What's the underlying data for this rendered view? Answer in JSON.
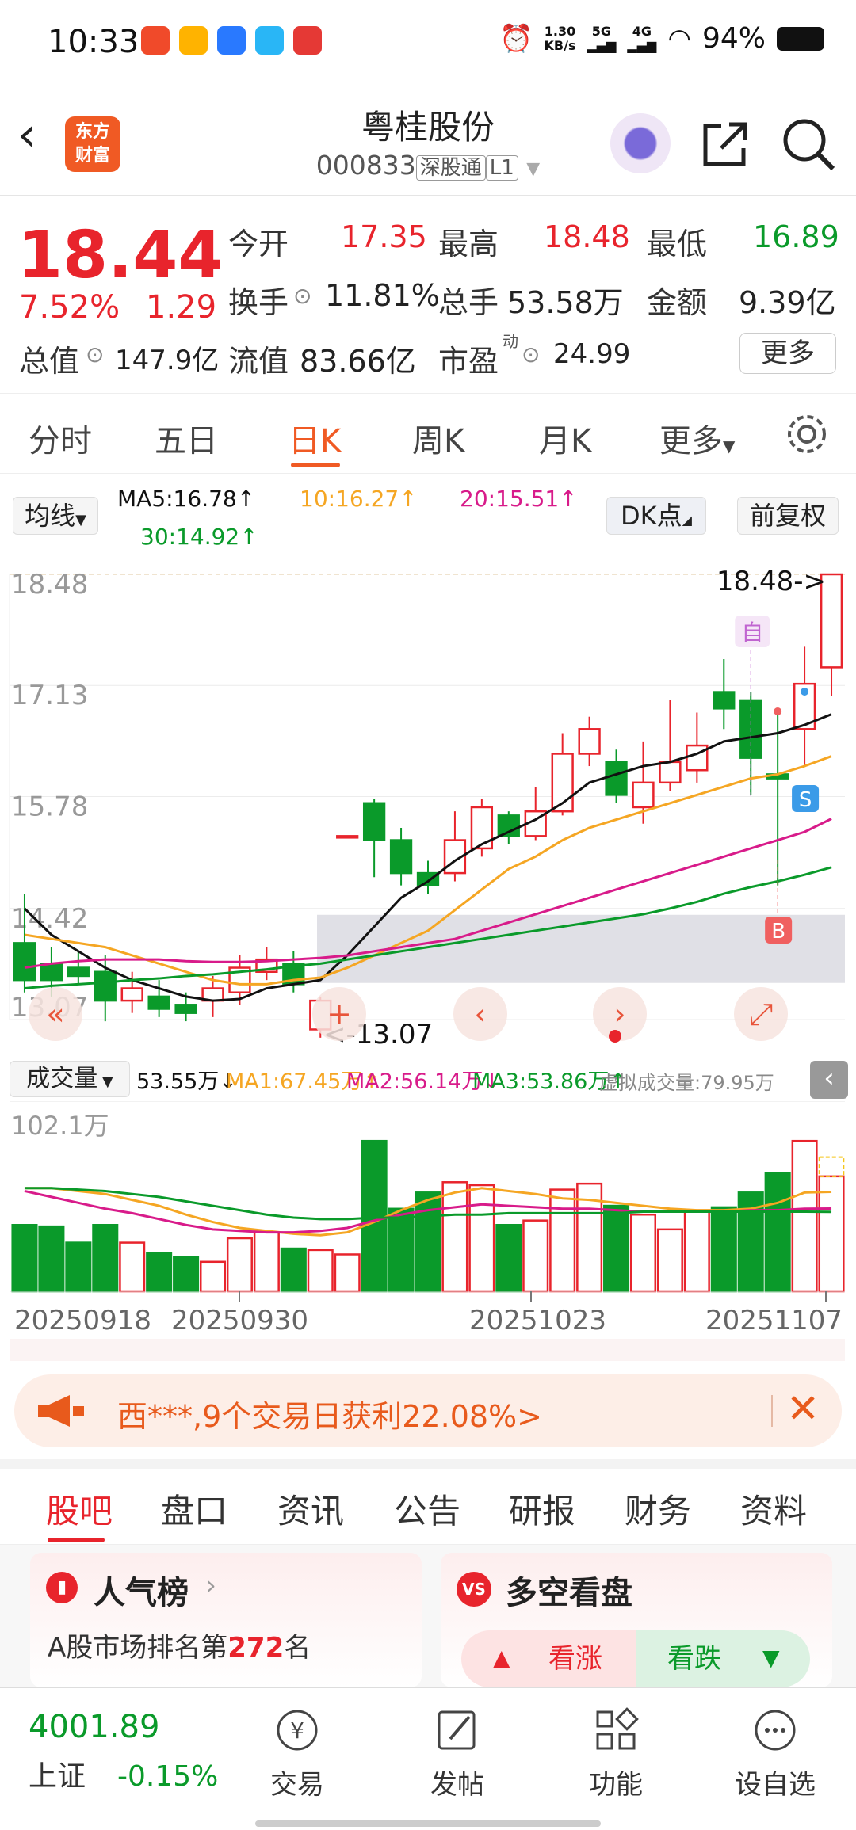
{
  "status": {
    "time": "10:33",
    "speed_value": "1.30",
    "speed_unit": "KB/s",
    "net1": "5G",
    "net2": "4G",
    "battery": "94%"
  },
  "header": {
    "logo_line1": "东方",
    "logo_line2": "财富",
    "stock_name": "粤桂股份",
    "stock_code": "000833",
    "tag1": "深股通",
    "tag2": "L1"
  },
  "quote": {
    "price": "18.44",
    "pct": "7.52%",
    "change": "1.29",
    "open_label": "今开",
    "open": "17.35",
    "high_label": "最高",
    "high": "18.48",
    "low_label": "最低",
    "low": "16.89",
    "turnover_label": "换手",
    "turnover": "11.81%",
    "volume_label": "总手",
    "volume": "53.58万",
    "amount_label": "金额",
    "amount": "9.39亿",
    "mcap_label": "总值",
    "mcap": "147.9亿",
    "float_label": "流值",
    "float": "83.66亿",
    "pe_label": "市盈",
    "pe_sup": "动",
    "pe": "24.99",
    "more": "更多"
  },
  "tabs": [
    "分时",
    "五日",
    "日K",
    "周K",
    "月K",
    "更多"
  ],
  "ma": {
    "selector": "均线",
    "ma5": "MA5:16.78",
    "ma10": "10:16.27",
    "ma20": "20:15.51",
    "ma30": "30:14.92",
    "dk": "DK点",
    "adjust": "前复权"
  },
  "chart_data": {
    "type": "candlestick",
    "y_ticks": [
      "18.48",
      "17.13",
      "15.78",
      "14.42",
      "13.07"
    ],
    "ylim": [
      13.07,
      18.48
    ],
    "high_marker": "18.48->",
    "low_marker": "<-13.07",
    "badge_zi": "自",
    "badge_s": "S",
    "badge_b": "B",
    "x_labels": [
      "20250918",
      "20250930",
      "20251023",
      "20251107"
    ],
    "candles": [
      [
        14.0,
        13.55,
        14.6,
        13.4
      ],
      [
        13.75,
        13.55,
        13.95,
        13.35
      ],
      [
        13.7,
        13.6,
        13.9,
        13.5
      ],
      [
        13.65,
        13.3,
        13.85,
        13.05
      ],
      [
        13.3,
        13.45,
        13.65,
        13.15
      ],
      [
        13.35,
        13.2,
        13.55,
        13.1
      ],
      [
        13.25,
        13.15,
        13.4,
        13.05
      ],
      [
        13.3,
        13.45,
        13.6,
        13.1
      ],
      [
        13.4,
        13.7,
        13.85,
        13.25
      ],
      [
        13.65,
        13.8,
        13.95,
        13.55
      ],
      [
        13.75,
        13.5,
        13.9,
        13.4
      ],
      [
        12.95,
        13.3,
        13.35,
        12.85
      ],
      [
        15.3,
        15.3,
        15.3,
        15.3
      ],
      [
        15.7,
        15.25,
        15.75,
        14.8
      ],
      [
        15.25,
        14.85,
        15.4,
        14.7
      ],
      [
        14.85,
        14.7,
        15.0,
        14.6
      ],
      [
        14.85,
        15.25,
        15.6,
        14.75
      ],
      [
        15.15,
        15.65,
        15.75,
        15.05
      ],
      [
        15.55,
        15.3,
        15.6,
        15.2
      ],
      [
        15.3,
        15.6,
        15.9,
        15.25
      ],
      [
        15.6,
        16.3,
        16.55,
        15.55
      ],
      [
        16.3,
        16.6,
        16.75,
        16.15
      ],
      [
        16.2,
        15.8,
        16.35,
        15.7
      ],
      [
        15.65,
        15.95,
        16.45,
        15.45
      ],
      [
        15.95,
        16.2,
        16.95,
        15.85
      ],
      [
        16.1,
        16.4,
        16.8,
        15.95
      ],
      [
        17.05,
        16.85,
        17.45,
        16.6
      ],
      [
        16.95,
        16.25,
        17.05,
        15.8
      ],
      [
        16.05,
        16.0,
        16.85,
        14.7
      ],
      [
        16.6,
        17.15,
        17.6,
        16.15
      ],
      [
        17.35,
        18.48,
        18.48,
        17.0
      ]
    ],
    "ma5": [
      14.42,
      14.1,
      13.9,
      13.7,
      13.55,
      13.45,
      13.35,
      13.3,
      13.32,
      13.45,
      13.5,
      13.55,
      13.85,
      14.2,
      14.55,
      14.75,
      15.0,
      15.2,
      15.35,
      15.5,
      15.7,
      15.95,
      16.05,
      16.15,
      16.2,
      16.3,
      16.45,
      16.5,
      16.55,
      16.65,
      16.78
    ],
    "ma10": [
      14.1,
      14.05,
      14.0,
      13.95,
      13.85,
      13.75,
      13.65,
      13.55,
      13.5,
      13.5,
      13.55,
      13.58,
      13.7,
      13.85,
      14.0,
      14.15,
      14.4,
      14.65,
      14.9,
      15.05,
      15.25,
      15.4,
      15.5,
      15.6,
      15.7,
      15.8,
      15.9,
      16.0,
      16.05,
      16.15,
      16.27
    ],
    "ma20": [
      13.7,
      13.75,
      13.78,
      13.8,
      13.8,
      13.8,
      13.78,
      13.77,
      13.77,
      13.78,
      13.8,
      13.82,
      13.85,
      13.9,
      13.95,
      14.0,
      14.05,
      14.15,
      14.25,
      14.35,
      14.45,
      14.55,
      14.65,
      14.75,
      14.85,
      14.95,
      15.05,
      15.15,
      15.25,
      15.35,
      15.51
    ],
    "ma30": [
      13.45,
      13.48,
      13.5,
      13.52,
      13.55,
      13.57,
      13.6,
      13.62,
      13.65,
      13.68,
      13.72,
      13.75,
      13.8,
      13.85,
      13.9,
      13.95,
      14.0,
      14.05,
      14.1,
      14.15,
      14.2,
      14.25,
      14.3,
      14.35,
      14.42,
      14.5,
      14.6,
      14.68,
      14.75,
      14.83,
      14.92
    ],
    "volume": {
      "max_label": "102.1万",
      "values": [
        45,
        44,
        33,
        45,
        33,
        26,
        23,
        20,
        36,
        40,
        29,
        28,
        25,
        102,
        56,
        67,
        74,
        72,
        45,
        48,
        69,
        73,
        58,
        52,
        42,
        55,
        57,
        67,
        80,
        102,
        78
      ],
      "ma1": [
        70,
        70,
        68,
        66,
        62,
        58,
        52,
        47,
        43,
        41,
        39,
        38,
        40,
        47,
        55,
        62,
        67,
        70,
        68,
        66,
        63,
        62,
        60,
        58,
        56,
        55,
        55,
        56,
        60,
        67,
        67.45
      ],
      "ma2": [
        68,
        64,
        60,
        56,
        53,
        49,
        45,
        42,
        41,
        40,
        40,
        41,
        43,
        48,
        52,
        55,
        57,
        59,
        58,
        57,
        56,
        56,
        55,
        54,
        54,
        54,
        54,
        55,
        55,
        56,
        56.14
      ],
      "ma3": [
        70,
        70,
        69,
        68,
        66,
        64,
        61,
        58,
        55,
        52,
        50,
        49,
        49,
        50,
        50,
        51,
        52,
        52,
        53,
        53,
        53,
        53,
        53,
        54,
        54,
        54,
        54,
        54,
        54,
        54,
        53.86
      ]
    }
  },
  "volume_bar": {
    "selector": "成交量",
    "vol": "53.55万",
    "ma1": "MA1:67.45万",
    "ma2": "MA2:56.14万",
    "ma3": "MA3:53.86万",
    "virtual": "虚拟成交量:79.95万"
  },
  "promo": {
    "text": "西***,9个交易日获利22.08%>"
  },
  "subtabs": [
    "股吧",
    "盘口",
    "资讯",
    "公告",
    "研报",
    "财务",
    "资料"
  ],
  "cards": {
    "left_title": "人气榜",
    "left_line1_pre": "A股市场排名第",
    "left_rank": "272",
    "left_line1_post": "名",
    "right_title": "多空看盘",
    "bull": "看涨",
    "bear": "看跌"
  },
  "bottom": {
    "index_value": "4001.89",
    "index_name": "上证",
    "index_change": "-0.15%",
    "trade": "交易",
    "post": "发帖",
    "func": "功能",
    "custom": "设自选"
  },
  "colors": {
    "red": "#e8242c",
    "green": "#0a9a2a",
    "accent": "#f05a24",
    "ma5": "#111111",
    "ma10": "#f5a623",
    "ma20": "#d81b8a",
    "ma30": "#0a9a2a"
  }
}
